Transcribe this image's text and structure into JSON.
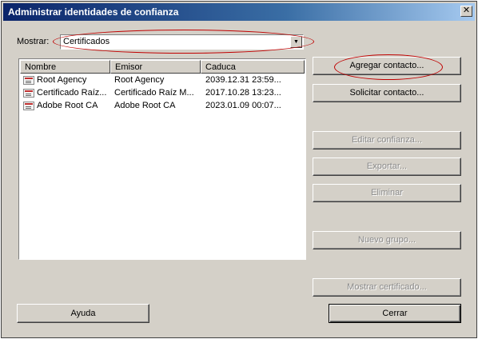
{
  "window": {
    "title": "Administrar identidades de confianza"
  },
  "filter": {
    "label": "Mostrar:",
    "selected": "Certificados"
  },
  "list": {
    "columns": [
      "Nombre",
      "Emisor",
      "Caduca"
    ],
    "rows": [
      {
        "name": "Root Agency",
        "issuer": "Root Agency",
        "expires": "2039.12.31 23:59..."
      },
      {
        "name": "Certificado Raíz...",
        "issuer": "Certificado Raíz M...",
        "expires": "2017.10.28 13:23..."
      },
      {
        "name": "Adobe Root CA",
        "issuer": "Adobe Root CA",
        "expires": "2023.01.09 00:07..."
      }
    ]
  },
  "buttons": {
    "add_contact": "Agregar contacto...",
    "request_contact": "Solicitar contacto...",
    "edit_trust": "Editar confianza...",
    "export": "Exportar...",
    "delete": "Eliminar",
    "new_group": "Nuevo grupo...",
    "show_certificate": "Mostrar certificado...",
    "help": "Ayuda",
    "close": "Cerrar",
    "close_glyph": "✕"
  },
  "colors": {
    "highlight_ellipse": "#c00000",
    "titlebar": "#0a246a"
  }
}
